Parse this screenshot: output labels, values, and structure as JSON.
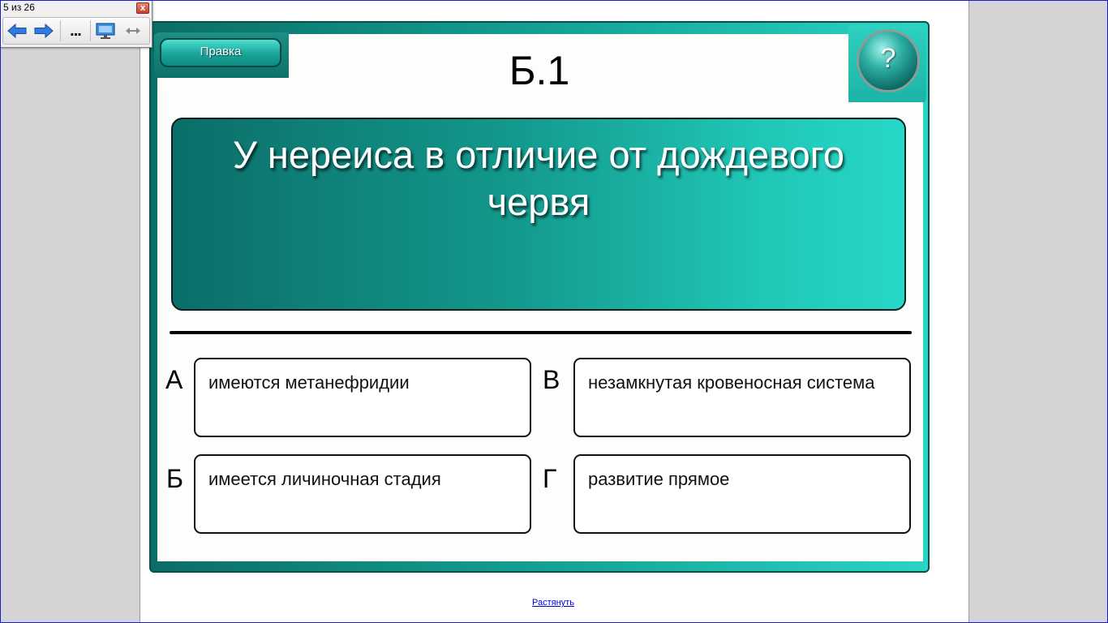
{
  "navbar": {
    "counter": "5 из 26",
    "close_label": "x",
    "more_label": "...",
    "icons": [
      "arrow-left-icon",
      "arrow-right-icon",
      "more-icon",
      "slideshow-monitor-icon",
      "resize-horizontal-icon"
    ]
  },
  "slide": {
    "edit_label": "Правка",
    "help_label": "?",
    "title": "Б.1",
    "question": "У нереиса в отличие от дождевого червя",
    "answers": [
      {
        "letter": "А",
        "text": "имеются метанефридии"
      },
      {
        "letter": "В",
        "text": "незамкнутая кровеносная система"
      },
      {
        "letter": "Б",
        "text": "имеется личиночная стадия"
      },
      {
        "letter": "Г",
        "text": "развитие прямое"
      }
    ],
    "colors": {
      "frame_dark": "#0b6d66",
      "frame_light": "#2ad4c4",
      "panel": "#fdfdfb"
    }
  },
  "footer": {
    "stretch_link": "Растянуть"
  }
}
